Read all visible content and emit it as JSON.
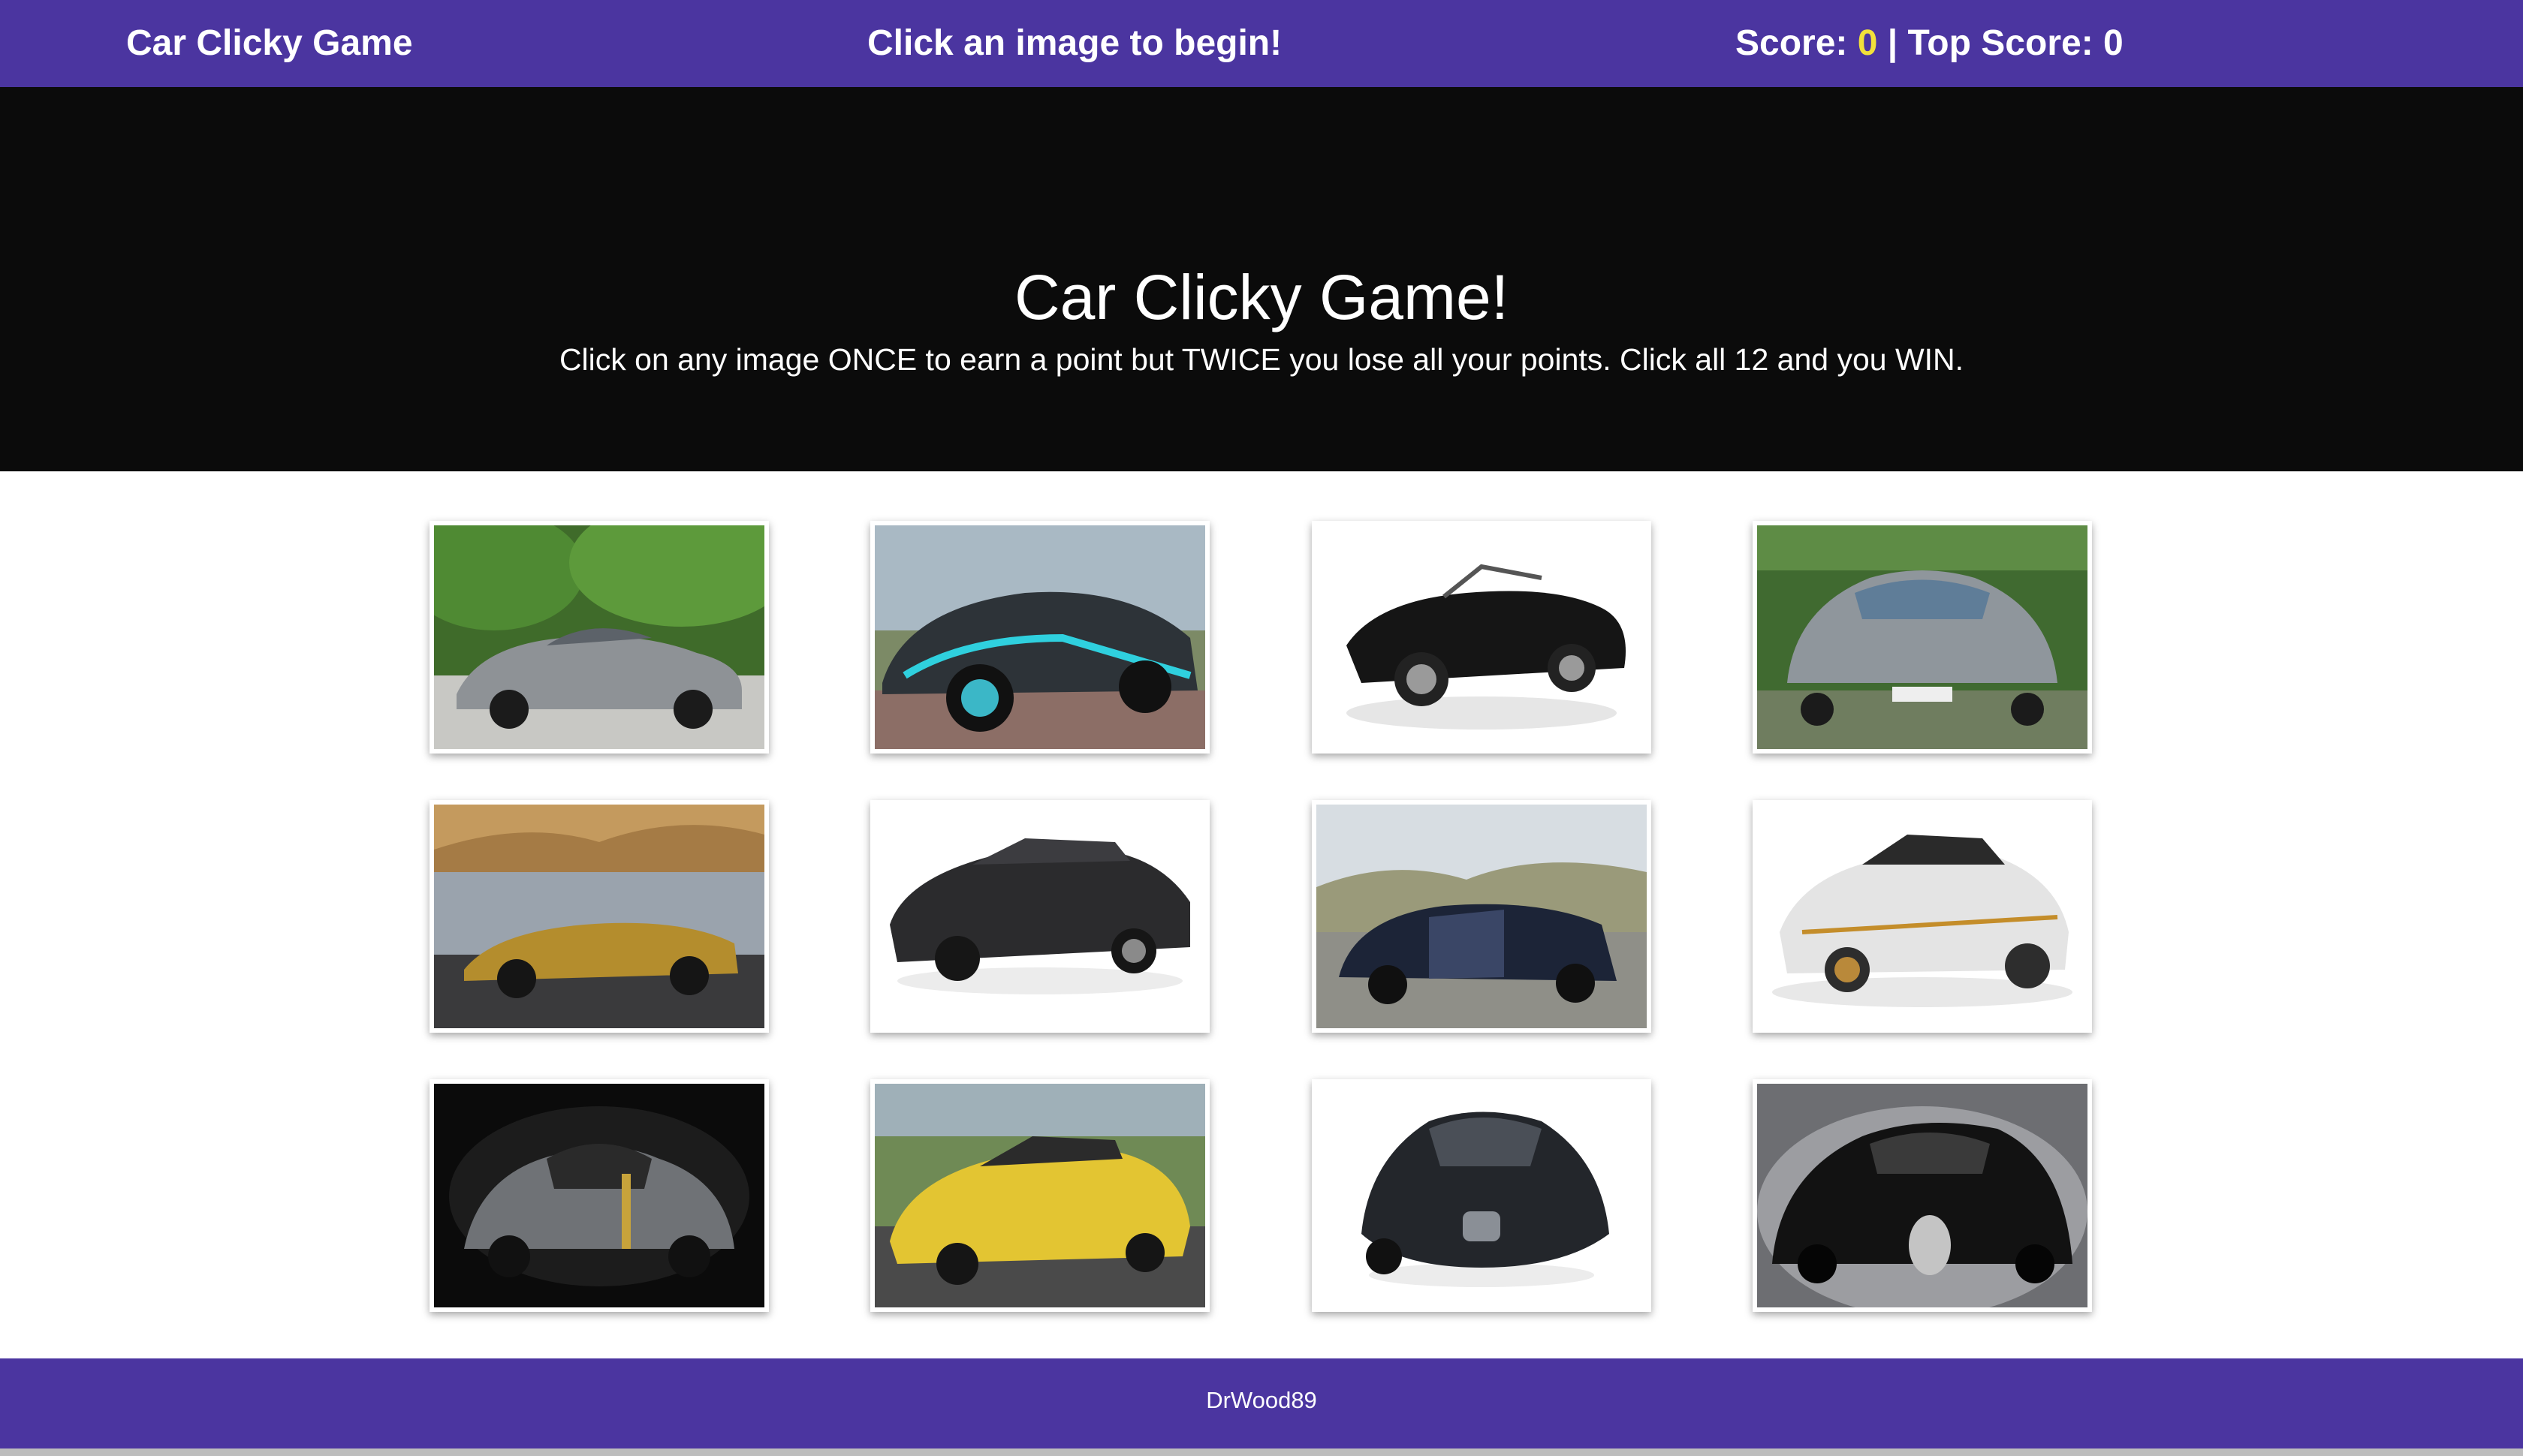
{
  "navbar": {
    "brand": "Car Clicky Game",
    "status": "Click an image to begin!",
    "score_label": "Score: ",
    "score_value": "0",
    "separator": " | ",
    "top_score_label": "Top Score: ",
    "top_score_value": "0"
  },
  "jumbotron": {
    "title": "Car Clicky Game!",
    "subtitle": "Click on any image ONCE to earn a point but TWICE you lose all your points. Click all 12 and you WIN."
  },
  "cards": [
    {
      "name": "car-card-1",
      "scene": "silver-coupe-trees"
    },
    {
      "name": "car-card-2",
      "scene": "concept-car-cyan"
    },
    {
      "name": "car-card-3",
      "scene": "black-convertible-white"
    },
    {
      "name": "car-card-4",
      "scene": "silver-amg-front"
    },
    {
      "name": "car-card-5",
      "scene": "gold-roadster-lake"
    },
    {
      "name": "car-card-6",
      "scene": "black-muscle-car"
    },
    {
      "name": "car-card-7",
      "scene": "blue-hypercar-road"
    },
    {
      "name": "car-card-8",
      "scene": "white-muscle-car"
    },
    {
      "name": "car-card-9",
      "scene": "silver-retro-studio"
    },
    {
      "name": "car-card-10",
      "scene": "yellow-sports-car"
    },
    {
      "name": "car-card-11",
      "scene": "dark-grey-coupe"
    },
    {
      "name": "car-card-12",
      "scene": "black-hypercar-studio"
    }
  ],
  "footer": {
    "text": "DrWood89"
  }
}
